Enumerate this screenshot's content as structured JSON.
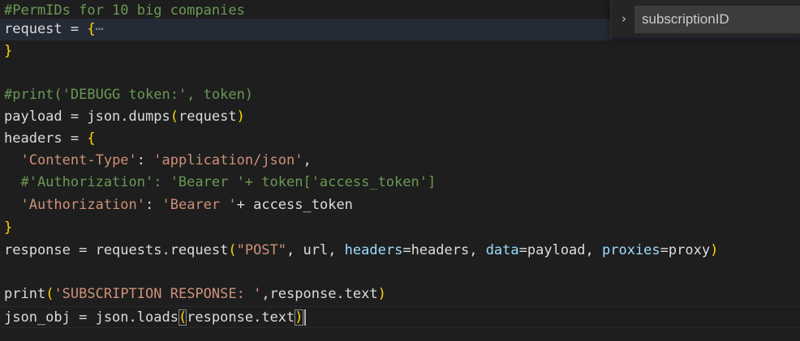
{
  "editor": {
    "lines": [
      {
        "segments": [
          {
            "t": "#PermIDs for 10 big companies",
            "c": "c-comment"
          }
        ]
      },
      {
        "segments": [
          {
            "t": "request = ",
            "c": "c-ident"
          },
          {
            "t": "{",
            "c": "c-brace"
          },
          {
            "t": "⋯",
            "c": "c-fold"
          }
        ]
      },
      {
        "segments": [
          {
            "t": "}",
            "c": "c-brace"
          }
        ]
      },
      {
        "segments": []
      },
      {
        "segments": [
          {
            "t": "#print('DEBUGG token:', token)",
            "c": "c-comment"
          }
        ]
      },
      {
        "segments": [
          {
            "t": "payload = json.dumps",
            "c": "c-ident"
          },
          {
            "t": "(",
            "c": "c-brace"
          },
          {
            "t": "request",
            "c": "c-ident"
          },
          {
            "t": ")",
            "c": "c-brace"
          }
        ]
      },
      {
        "segments": [
          {
            "t": "headers = ",
            "c": "c-ident"
          },
          {
            "t": "{",
            "c": "c-brace"
          }
        ]
      },
      {
        "segments": [
          {
            "t": "  ",
            "c": "c-ident"
          },
          {
            "t": "'Content-Type'",
            "c": "c-string"
          },
          {
            "t": ": ",
            "c": "c-ident"
          },
          {
            "t": "'application/json'",
            "c": "c-string"
          },
          {
            "t": ",",
            "c": "c-ident"
          }
        ]
      },
      {
        "segments": [
          {
            "t": "  #'Authorization': 'Bearer '+ token['access_token']",
            "c": "c-comment"
          }
        ]
      },
      {
        "segments": [
          {
            "t": "  ",
            "c": "c-ident"
          },
          {
            "t": "'Authorization'",
            "c": "c-string"
          },
          {
            "t": ": ",
            "c": "c-ident"
          },
          {
            "t": "'Bearer '",
            "c": "c-string"
          },
          {
            "t": "+ access_token",
            "c": "c-ident"
          }
        ]
      },
      {
        "segments": [
          {
            "t": "}",
            "c": "c-brace"
          }
        ]
      },
      {
        "segments": [
          {
            "t": "response = requests.request",
            "c": "c-ident"
          },
          {
            "t": "(",
            "c": "c-brace"
          },
          {
            "t": "\"POST\"",
            "c": "c-string"
          },
          {
            "t": ", url, ",
            "c": "c-ident"
          },
          {
            "t": "headers",
            "c": "c-param"
          },
          {
            "t": "=headers, ",
            "c": "c-ident"
          },
          {
            "t": "data",
            "c": "c-param"
          },
          {
            "t": "=payload, ",
            "c": "c-ident"
          },
          {
            "t": "proxies",
            "c": "c-param"
          },
          {
            "t": "=proxy",
            "c": "c-ident"
          },
          {
            "t": ")",
            "c": "c-brace"
          }
        ]
      },
      {
        "segments": []
      },
      {
        "segments": [
          {
            "t": "print",
            "c": "c-ident"
          },
          {
            "t": "(",
            "c": "c-brace"
          },
          {
            "t": "'SUBSCRIPTION RESPONSE: '",
            "c": "c-string"
          },
          {
            "t": ",response.text",
            "c": "c-ident"
          },
          {
            "t": ")",
            "c": "c-brace"
          }
        ]
      },
      {
        "segments": [
          {
            "t": "json_obj = json.loads",
            "c": "c-ident"
          },
          {
            "t": "(",
            "c": "c-bracket-match"
          },
          {
            "t": "response.text",
            "c": "c-ident"
          },
          {
            "t": ")",
            "c": "c-bracket-match"
          }
        ]
      }
    ]
  },
  "find": {
    "toggle_icon": "chevron-right-icon",
    "toggle_glyph": "›",
    "query": "subscriptionID"
  },
  "colors": {
    "background": "#1e1e1e",
    "comment": "#6a9955",
    "string": "#ce9178",
    "brace": "#ffd700",
    "parameter": "#9cdcfe"
  }
}
